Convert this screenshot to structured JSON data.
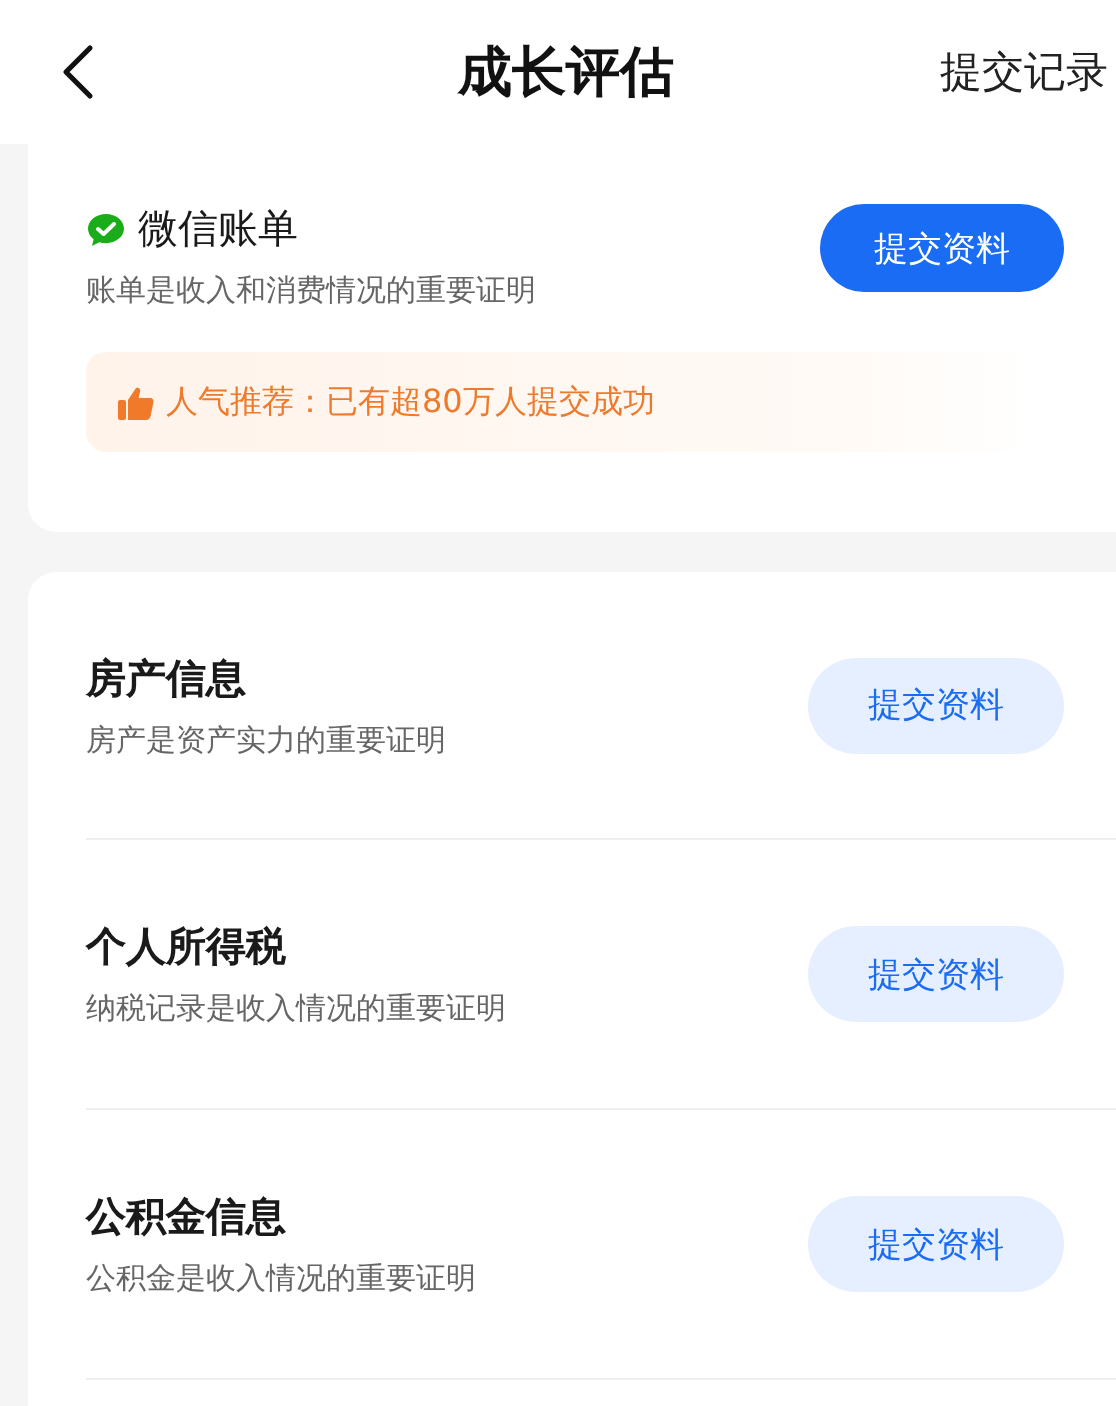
{
  "header": {
    "title": "成长评估",
    "action": "提交记录"
  },
  "featured": {
    "title": "微信账单",
    "description": "账单是收入和消费情况的重要证明",
    "button": {
      "label": "提交资料",
      "kind": "primary"
    },
    "tip": "人气推荐：已有超80万人提交成功"
  },
  "items": [
    {
      "title": "房产信息",
      "description": "房产是资产实力的重要证明",
      "button": {
        "label": "提交资料",
        "kind": "secondary"
      }
    },
    {
      "title": "个人所得税",
      "description": "纳税记录是收入情况的重要证明",
      "button": {
        "label": "提交资料",
        "kind": "secondary"
      }
    },
    {
      "title": "公积金信息",
      "description": "公积金是收入情况的重要证明",
      "button": {
        "label": "提交资料",
        "kind": "secondary"
      }
    }
  ]
}
